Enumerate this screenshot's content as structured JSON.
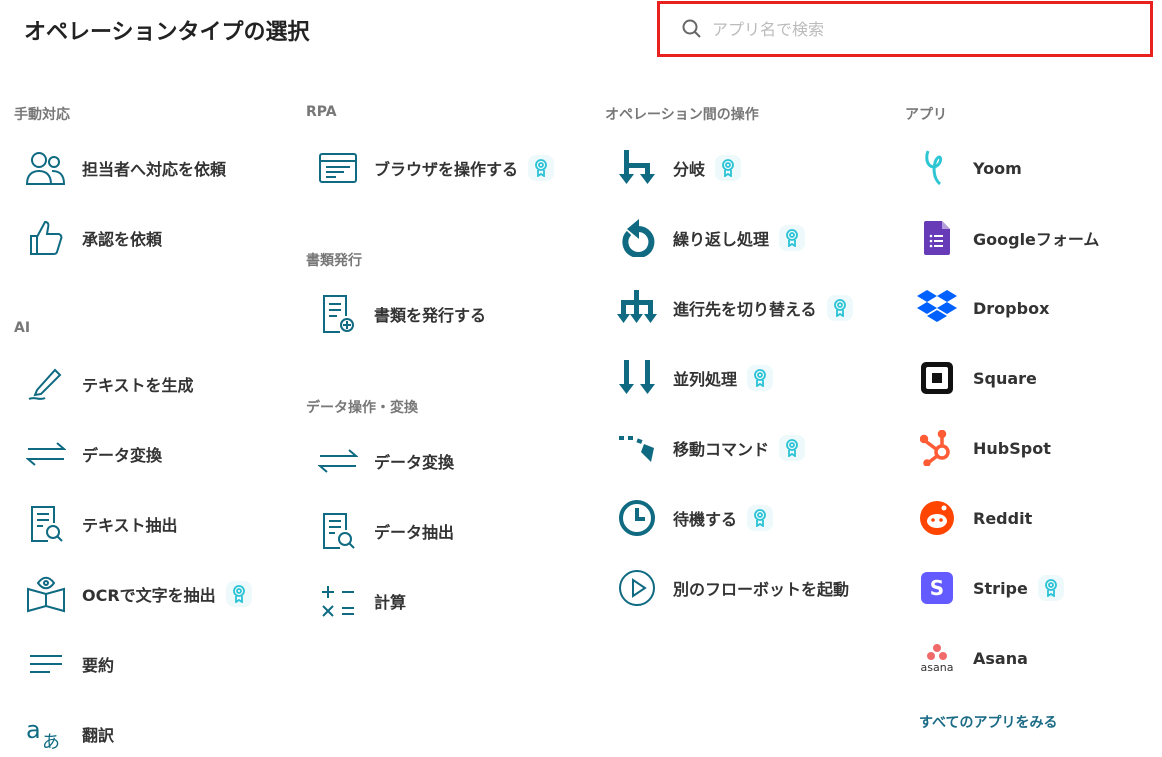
{
  "title": "オペレーションタイプの選択",
  "search": {
    "placeholder": "アプリ名で検索",
    "value": ""
  },
  "colors": {
    "icon": "#0f6a82",
    "badge": "#2ac3d6",
    "search_border": "#e8201e"
  },
  "columns": [
    {
      "sections": [
        {
          "heading": "手動対応",
          "items": [
            {
              "label": "担当者へ対応を依頼",
              "icon": "users-icon"
            },
            {
              "label": "承認を依頼",
              "icon": "thumbs-up-icon"
            }
          ]
        },
        {
          "heading": "AI",
          "items": [
            {
              "label": "テキストを生成",
              "icon": "pen-icon"
            },
            {
              "label": "データ変換",
              "icon": "arrows-exchange-icon"
            },
            {
              "label": "テキスト抽出",
              "icon": "document-search-icon"
            },
            {
              "label": "OCRで文字を抽出",
              "icon": "book-eye-icon",
              "badge": true
            },
            {
              "label": "要約",
              "icon": "lines-icon"
            },
            {
              "label": "翻訳",
              "icon": "translate-icon"
            }
          ]
        }
      ]
    },
    {
      "sections": [
        {
          "heading": "RPA",
          "items": [
            {
              "label": "ブラウザを操作する",
              "icon": "browser-icon",
              "badge": true
            }
          ]
        },
        {
          "heading": "書類発行",
          "items": [
            {
              "label": "書類を発行する",
              "icon": "document-plus-icon"
            }
          ]
        },
        {
          "heading": "データ操作・変換",
          "items": [
            {
              "label": "データ変換",
              "icon": "arrows-exchange-icon"
            },
            {
              "label": "データ抽出",
              "icon": "document-search-icon"
            },
            {
              "label": "計算",
              "icon": "calculator-icon"
            }
          ]
        }
      ]
    },
    {
      "sections": [
        {
          "heading": "オペレーション間の操作",
          "items": [
            {
              "label": "分岐",
              "icon": "branch-icon",
              "badge": true
            },
            {
              "label": "繰り返し処理",
              "icon": "loop-icon",
              "badge": true
            },
            {
              "label": "進行先を切り替える",
              "icon": "switch-icon",
              "badge": true
            },
            {
              "label": "並列処理",
              "icon": "parallel-icon",
              "badge": true
            },
            {
              "label": "移動コマンド",
              "icon": "move-icon",
              "badge": true
            },
            {
              "label": "待機する",
              "icon": "clock-icon",
              "badge": true
            },
            {
              "label": "別のフローボットを起動",
              "icon": "play-icon"
            }
          ]
        }
      ]
    },
    {
      "sections": [
        {
          "heading": "アプリ",
          "items": [
            {
              "label": "Yoom",
              "icon": "yoom-icon"
            },
            {
              "label": "Googleフォーム",
              "icon": "google-forms-icon"
            },
            {
              "label": "Dropbox",
              "icon": "dropbox-icon"
            },
            {
              "label": "Square",
              "icon": "square-icon"
            },
            {
              "label": "HubSpot",
              "icon": "hubspot-icon"
            },
            {
              "label": "Reddit",
              "icon": "reddit-icon"
            },
            {
              "label": "Stripe",
              "icon": "stripe-icon",
              "badge": true
            },
            {
              "label": "Asana",
              "icon": "asana-icon",
              "logo_text": "asana"
            }
          ]
        }
      ],
      "link": "すべてのアプリをみる"
    }
  ]
}
